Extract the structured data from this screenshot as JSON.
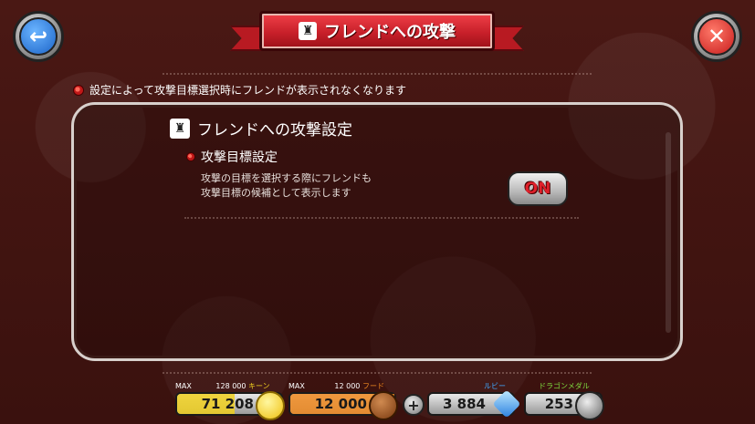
{
  "header": {
    "title": "フレンドへの攻撃",
    "back_icon": "back-arrow-icon",
    "close_icon": "close-x-icon"
  },
  "notice": {
    "text": "設定によって攻撃目標選択時にフレンドが表示されなくなります"
  },
  "panel": {
    "section_title": "フレンドへの攻撃設定",
    "setting": {
      "title": "攻撃目標設定",
      "description_line1": "攻撃の目標を選択する際にフレンドも",
      "description_line2": "攻撃目標の候補として表示します",
      "toggle_value": "ON"
    }
  },
  "resources": {
    "coin": {
      "max_prefix": "MAX",
      "max_value": "128 000",
      "unit": "キーン",
      "value": "71 208",
      "fill_fraction": 0.556,
      "color": "#f0d020"
    },
    "food": {
      "max_prefix": "MAX",
      "max_value": "12 000",
      "unit": "フード",
      "value": "12 000",
      "fill_fraction": 1.0,
      "color": "#f08a20"
    },
    "ruby": {
      "label": "ルビー",
      "value": "3 884",
      "color": "#40a8ff"
    },
    "medal": {
      "label": "ドラゴンメダル",
      "value": "253",
      "color": "#80e040"
    }
  }
}
